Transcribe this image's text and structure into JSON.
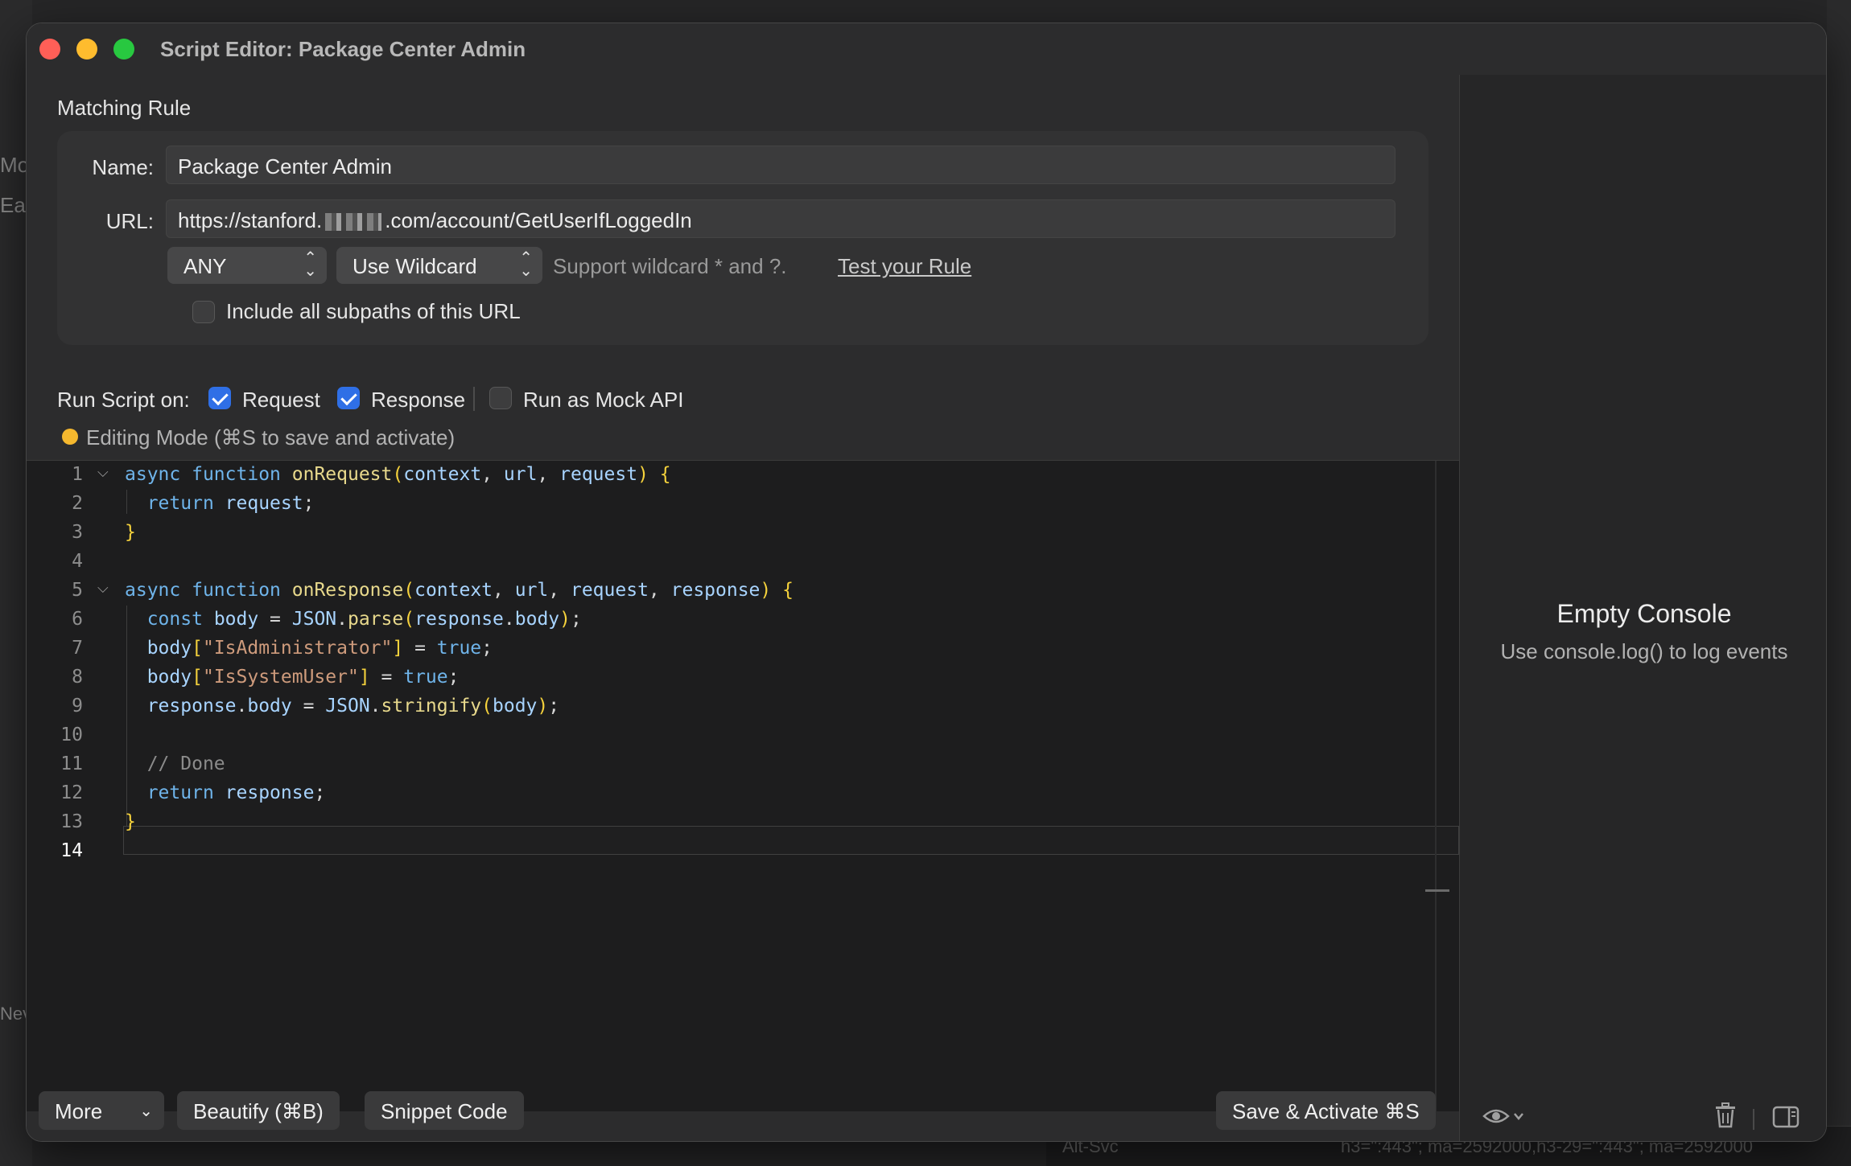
{
  "background": {
    "left_fragments": [
      "Mo",
      "Eac",
      "Nev"
    ],
    "bottom_left": "Alt-Svc",
    "bottom_right": "h3=\":443\"; ma=2592000,h3-29=\":443\"; ma=2592000"
  },
  "window": {
    "title": "Script Editor: Package Center Admin"
  },
  "matching_rule": {
    "section_label": "Matching Rule",
    "name_label": "Name:",
    "name_value": "Package Center Admin",
    "url_label": "URL:",
    "url_prefix": "https://stanford.",
    "url_suffix": ".com/account/GetUserIfLoggedIn",
    "method_select": "ANY",
    "match_select": "Use Wildcard",
    "wildcard_hint": "Support wildcard * and ?.",
    "test_link": "Test your Rule",
    "include_subpaths_label": "Include all subpaths of this URL",
    "include_subpaths_checked": false
  },
  "run_script": {
    "label": "Run Script on:",
    "request_label": "Request",
    "request_checked": true,
    "response_label": "Response",
    "response_checked": true,
    "mock_label": "Run as Mock API",
    "mock_checked": false
  },
  "status": {
    "text": "Editing Mode (⌘S to save and activate)",
    "color": "#f5b82e"
  },
  "editor": {
    "line_numbers": [
      "1",
      "2",
      "3",
      "4",
      "5",
      "6",
      "7",
      "8",
      "9",
      "10",
      "11",
      "12",
      "13",
      "14"
    ],
    "current_line": 14,
    "code": [
      "async function onRequest(context, url, request) {",
      "  return request;",
      "}",
      "",
      "async function onResponse(context, url, request, response) {",
      "  const body = JSON.parse(response.body);",
      "  body[\"IsAdministrator\"] = true;",
      "  body[\"IsSystemUser\"] = true;",
      "  response.body = JSON.stringify(body);",
      "",
      "  // Done",
      "  return response;",
      "}",
      ""
    ]
  },
  "toolbar": {
    "more_label": "More",
    "beautify_label": "Beautify (⌘B)",
    "snippet_label": "Snippet Code",
    "save_label": "Save & Activate ⌘S"
  },
  "console": {
    "title": "Empty Console",
    "subtitle": "Use console.log() to log events"
  },
  "icons": {
    "eye": "eye-icon",
    "trash": "trash-icon",
    "sidebar": "sidebar-toggle-icon"
  }
}
